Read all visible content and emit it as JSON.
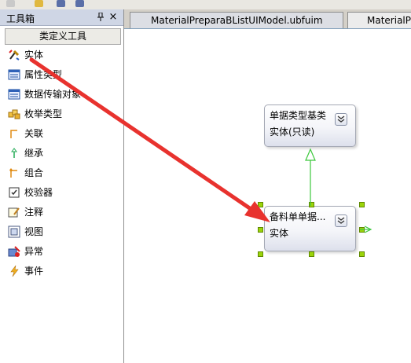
{
  "toolbox": {
    "title": "工具箱",
    "pin_icon": "pin-icon",
    "close_label": "×",
    "section_label": "类定义工具",
    "items": [
      {
        "label": "实体",
        "icon": "entity-icon"
      },
      {
        "label": "属性类型",
        "icon": "property-type-icon"
      },
      {
        "label": "数据传输对象",
        "icon": "dto-icon"
      },
      {
        "label": "枚举类型",
        "icon": "enum-icon"
      },
      {
        "label": "关联",
        "icon": "association-icon"
      },
      {
        "label": "继承",
        "icon": "inheritance-icon"
      },
      {
        "label": "组合",
        "icon": "composition-icon"
      },
      {
        "label": "校验器",
        "icon": "validator-icon"
      },
      {
        "label": "注释",
        "icon": "comment-icon"
      },
      {
        "label": "视图",
        "icon": "view-icon"
      },
      {
        "label": "异常",
        "icon": "exception-icon"
      },
      {
        "label": "事件",
        "icon": "event-icon"
      }
    ]
  },
  "tabs": [
    {
      "label": "MaterialPreparaBListUIModel.ubfuim"
    },
    {
      "label": "MaterialPr"
    }
  ],
  "diagram": {
    "base_shape": {
      "title": "单据类型基类",
      "subtitle": "实体(只读)"
    },
    "entity_shape": {
      "title": "备料单单据...",
      "subtitle": "实体"
    }
  },
  "colors": {
    "arrow": "#e8322e",
    "inheritance_line": "#3cc83c",
    "handle": "#9bd40a"
  }
}
